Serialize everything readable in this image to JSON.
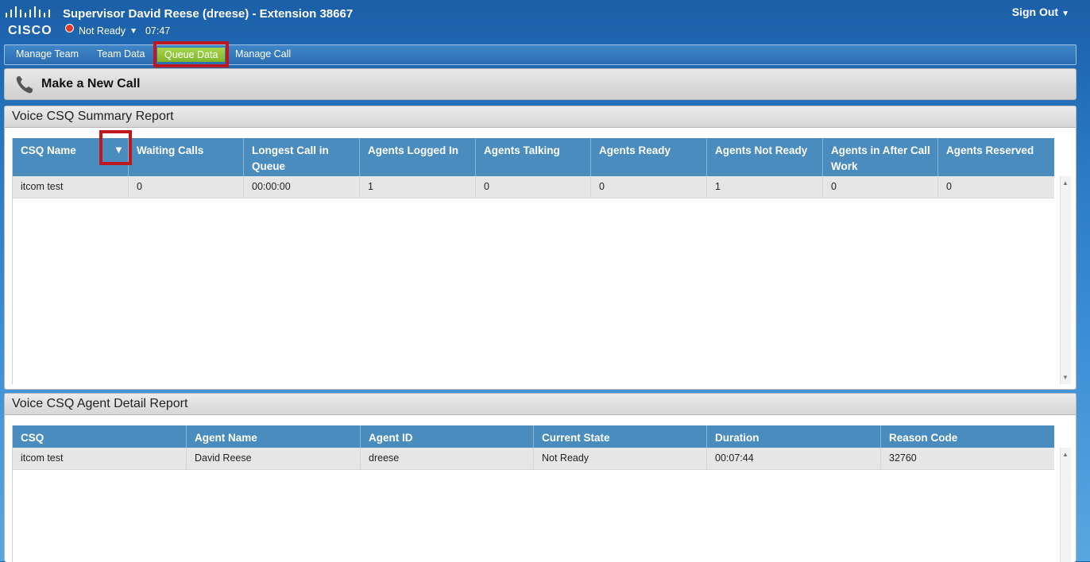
{
  "header": {
    "logo_text": "CISCO",
    "title": "Supervisor David Reese (dreese) - Extension 38667",
    "status": "Not Ready",
    "timer": "07:47",
    "sign_out": "Sign Out"
  },
  "nav": {
    "items": [
      "Manage Team",
      "Team Data",
      "Queue Data",
      "Manage Call"
    ],
    "active": "Queue Data"
  },
  "make_call": {
    "label": "Make a New Call"
  },
  "summary": {
    "title": "Voice CSQ Summary Report",
    "columns": [
      "CSQ Name",
      "Waiting Calls",
      "Longest Call in Queue",
      "Agents Logged In",
      "Agents Talking",
      "Agents Ready",
      "Agents Not Ready",
      "Agents in After Call Work",
      "Agents Reserved"
    ],
    "rows": [
      [
        "itcom test",
        "0",
        "00:00:00",
        "1",
        "0",
        "0",
        "1",
        "0",
        "0"
      ]
    ]
  },
  "detail": {
    "title": "Voice CSQ Agent Detail Report",
    "columns": [
      "CSQ",
      "Agent Name",
      "Agent ID",
      "Current State",
      "Duration",
      "Reason Code"
    ],
    "rows": [
      [
        "itcom test",
        "David Reese",
        "dreese",
        "Not Ready",
        "00:07:44",
        "32760"
      ]
    ]
  },
  "colors": {
    "header_bg": "#1b5fa8",
    "grid_header": "#4a8cbd",
    "active_tab": "#8cc23a",
    "highlight": "#c0161d",
    "status_red": "#e03a2e"
  },
  "icons": [
    "cisco-logo-icon",
    "status-not-ready-icon",
    "phone-icon",
    "sort-caret-icon",
    "scroll-up-icon",
    "scroll-down-icon"
  ]
}
